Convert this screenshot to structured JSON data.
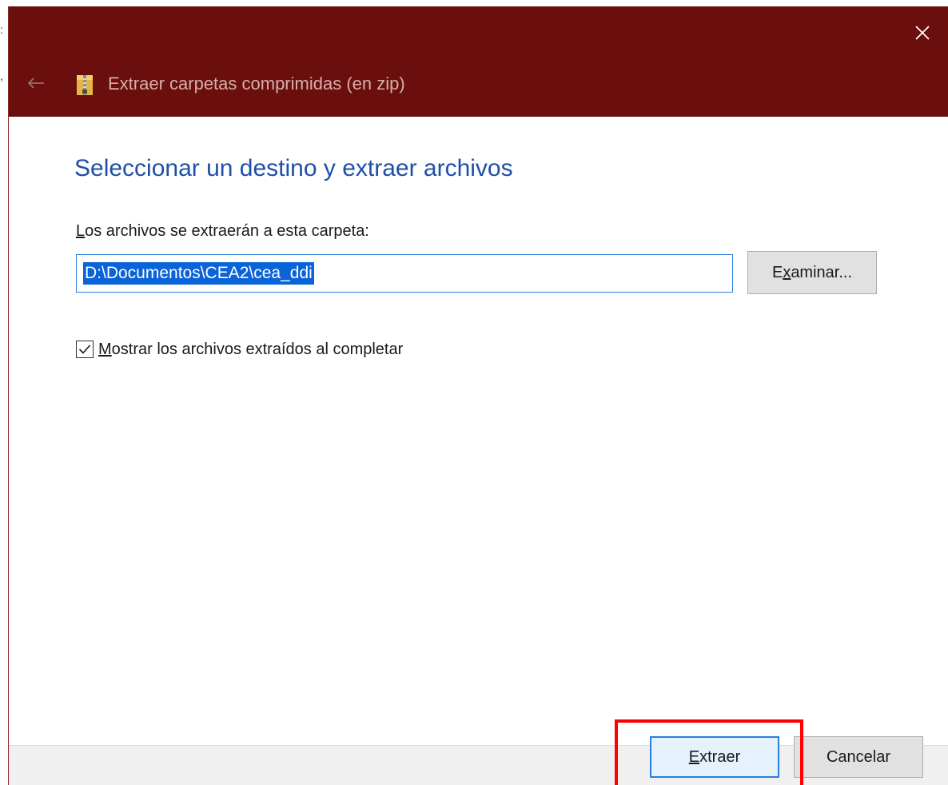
{
  "window": {
    "title": "Extraer carpetas comprimidas (en zip)",
    "titlebar_color": "#6a0f0d",
    "accent_color": "#1f4fa8"
  },
  "content": {
    "heading": "Seleccionar un destino y extraer archivos",
    "field_label_accel": "L",
    "field_label_rest": "os archivos se extraerán a esta carpeta:",
    "destination_value": "D:\\Documentos\\CEA2\\cea_ddi",
    "browse_button_pre": "E",
    "browse_button_accel": "x",
    "browse_button_rest": "aminar...",
    "show_files_checked": true,
    "show_files_accel": "M",
    "show_files_rest": "ostrar los archivos extraídos al completar"
  },
  "footer": {
    "extract_accel": "E",
    "extract_rest": "xtraer",
    "cancel_label": "Cancelar",
    "highlight_color": "#ff0000"
  },
  "icons": {
    "close": "close-icon",
    "back": "arrow-left-icon",
    "zip": "zip-folder-icon",
    "check": "checkmark-icon"
  }
}
